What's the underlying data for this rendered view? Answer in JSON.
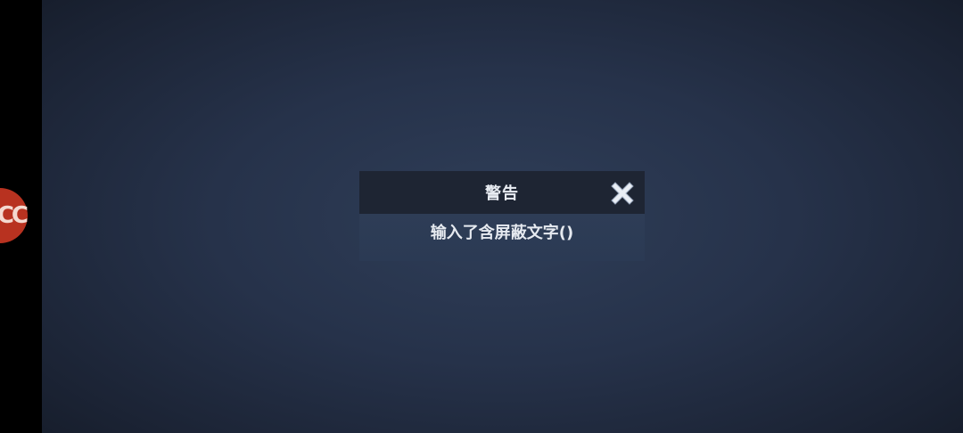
{
  "floating_badge": {
    "text": "CC",
    "color": "#b83220"
  },
  "dialog": {
    "title": "警告",
    "message": "输入了含屏蔽文字()",
    "close_icon": "close-x-icon"
  },
  "colors": {
    "header_bg": "#1e2533",
    "body_bg": "#2e3d56",
    "screen_bg": "#26324a",
    "text": "#e8ecf2"
  }
}
